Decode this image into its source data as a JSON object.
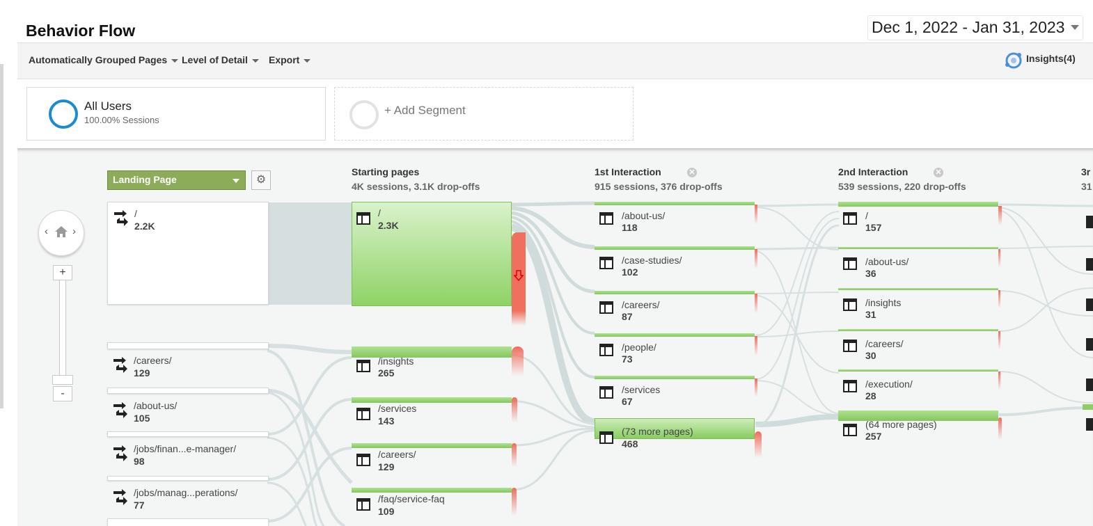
{
  "header": {
    "title": "Behavior Flow",
    "date_range": "Dec 1, 2022 - Jan 31, 2023"
  },
  "toolbar": {
    "grouping_label": "Automatically Grouped Pages",
    "detail_label": "Level of Detail",
    "export_label": "Export",
    "insights_label": "Insights(4)"
  },
  "segments": {
    "active": {
      "name": "All Users",
      "detail": "100.00% Sessions"
    },
    "add_label": "+ Add Segment"
  },
  "flow": {
    "dimension_select": "Landing Page",
    "columns": [
      {
        "title": "Starting pages",
        "summary": "4K sessions, 3.1K drop-offs"
      },
      {
        "title": "1st Interaction",
        "summary": "915 sessions, 376 drop-offs"
      },
      {
        "title": "2nd Interaction",
        "summary": "539 sessions, 220 drop-offs"
      },
      {
        "title": "3r",
        "summary": "31"
      }
    ],
    "landing_pages": [
      {
        "name": "/",
        "count": "2.2K"
      },
      {
        "name": "/careers/",
        "count": "129"
      },
      {
        "name": "/about-us/",
        "count": "105"
      },
      {
        "name": "/jobs/finan...e-manager/",
        "count": "98"
      },
      {
        "name": "/jobs/manag...perations/",
        "count": "77"
      }
    ],
    "starting_pages": [
      {
        "name": "/",
        "count": "2.3K"
      },
      {
        "name": "/insights",
        "count": "265"
      },
      {
        "name": "/services",
        "count": "143"
      },
      {
        "name": "/careers/",
        "count": "129"
      },
      {
        "name": "/faq/service-faq",
        "count": "109"
      }
    ],
    "first_interaction": [
      {
        "name": "/about-us/",
        "count": "118"
      },
      {
        "name": "/case-studies/",
        "count": "102"
      },
      {
        "name": "/careers/",
        "count": "87"
      },
      {
        "name": "/people/",
        "count": "73"
      },
      {
        "name": "/services",
        "count": "67"
      },
      {
        "name": "(73 more pages)",
        "count": "468"
      }
    ],
    "second_interaction": [
      {
        "name": "/",
        "count": "157"
      },
      {
        "name": "/about-us/",
        "count": "36"
      },
      {
        "name": "/insights",
        "count": "31"
      },
      {
        "name": "/careers/",
        "count": "30"
      },
      {
        "name": "/execution/",
        "count": "28"
      },
      {
        "name": "(64 more pages)",
        "count": "257"
      }
    ]
  }
}
